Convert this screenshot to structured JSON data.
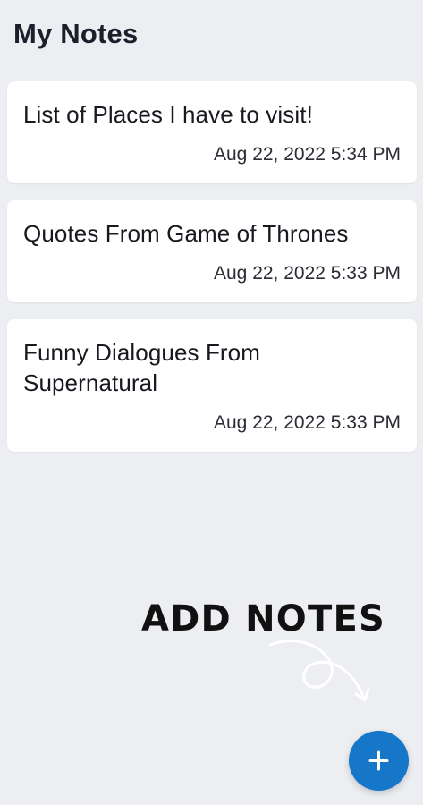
{
  "header": {
    "title": "My Notes"
  },
  "notes": [
    {
      "title": "List of Places I have to visit!",
      "timestamp": "Aug 22, 2022 5:34 PM"
    },
    {
      "title": "Quotes From Game of Thrones",
      "timestamp": "Aug 22, 2022 5:33 PM"
    },
    {
      "title": "Funny Dialogues From Supernatural",
      "timestamp": "Aug 22, 2022 5:33 PM"
    }
  ],
  "callout": {
    "label": "ADD NOTES"
  },
  "fab": {
    "icon": "plus-icon",
    "color": "#1677c9"
  },
  "colors": {
    "background": "#eceef2",
    "card": "#ffffff",
    "accent": "#1677c9"
  }
}
